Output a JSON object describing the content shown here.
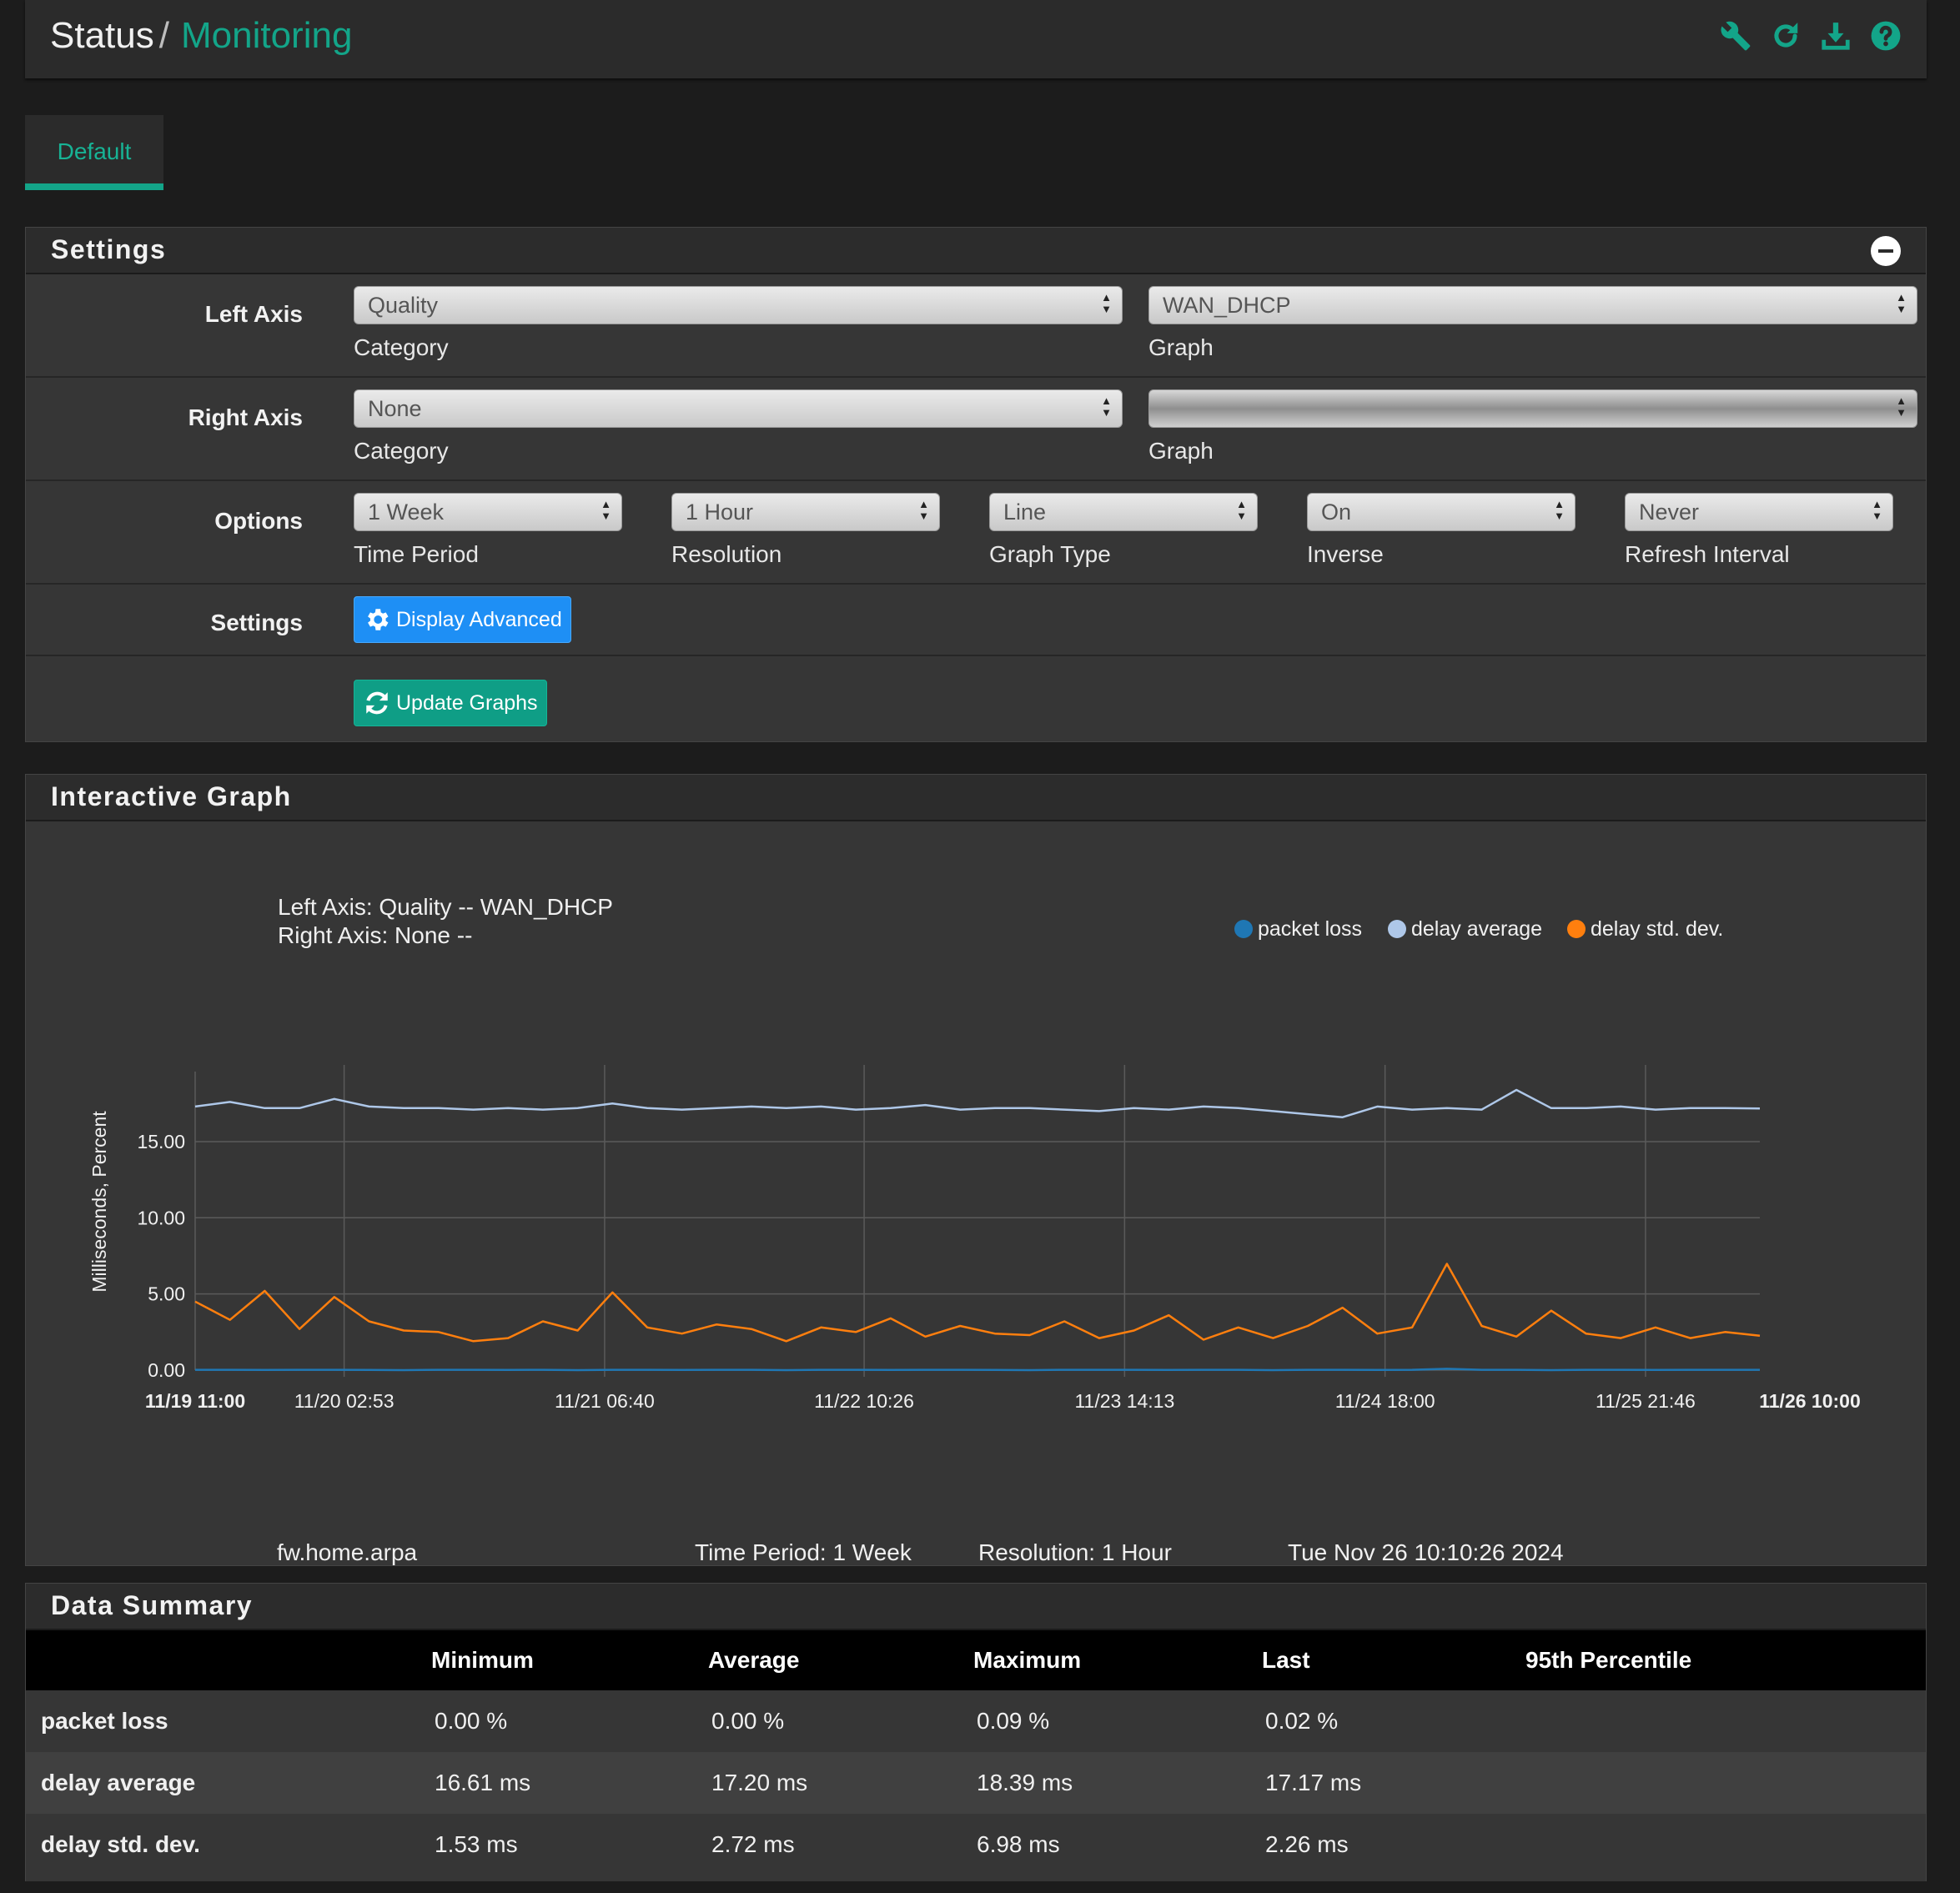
{
  "breadcrumb": {
    "root": "Status",
    "separator": "/",
    "current": "Monitoring"
  },
  "header_icons": [
    "wrench-icon",
    "refresh-icon",
    "download-icon",
    "help-icon"
  ],
  "colors": {
    "accent": "#13a589",
    "primary_button": "#1e8ff5",
    "success_button": "#0f9e86",
    "packet_loss": "#1f77b4",
    "delay_average": "#aec7e8",
    "delay_std_dev": "#ff7f0e"
  },
  "tabs": [
    {
      "label": "Default",
      "active": true
    }
  ],
  "settings": {
    "title": "Settings",
    "left_axis": {
      "label": "Left Axis",
      "category": "Quality",
      "category_label": "Category",
      "graph": "WAN_DHCP",
      "graph_label": "Graph"
    },
    "right_axis": {
      "label": "Right Axis",
      "category": "None",
      "category_label": "Category",
      "graph": "",
      "graph_label": "Graph"
    },
    "options": {
      "label": "Options",
      "time_period": {
        "value": "1 Week",
        "label": "Time Period"
      },
      "resolution": {
        "value": "1 Hour",
        "label": "Resolution"
      },
      "graph_type": {
        "value": "Line",
        "label": "Graph Type"
      },
      "inverse": {
        "value": "On",
        "label": "Inverse"
      },
      "refresh_interval": {
        "value": "Never",
        "label": "Refresh Interval"
      }
    },
    "settings_row": {
      "label": "Settings",
      "display_advanced": "Display Advanced"
    },
    "update_graphs": "Update Graphs"
  },
  "graph": {
    "title": "Interactive Graph",
    "left_axis_info": "Left Axis: Quality -- WAN_DHCP",
    "right_axis_info": "Right Axis: None --",
    "hostname": "fw.home.arpa",
    "time_period": "Time Period: 1 Week",
    "resolution": "Resolution: 1 Hour",
    "timestamp": "Tue Nov 26 10:10:26 2024"
  },
  "chart_data": {
    "type": "line",
    "ylabel": "Milliseconds, Percent",
    "ylim": [
      0,
      18.5
    ],
    "y_ticks": [
      "0.00",
      "5.00",
      "10.00",
      "15.00"
    ],
    "x_start_label": "11/19 11:00",
    "x_end_label": "11/26 10:00",
    "x_ticks": [
      "11/20 02:53",
      "11/21 06:40",
      "11/22 10:26",
      "11/23 14:13",
      "11/24 18:00",
      "11/25 21:46"
    ],
    "x_tick_hours": [
      15.9,
      43.7,
      71.4,
      99.2,
      127.0,
      154.8
    ],
    "total_hours": 167,
    "legend_position": "top-right",
    "grid": true,
    "series": [
      {
        "name": "packet loss",
        "values": [
          0.02,
          0.02,
          0.01,
          0.02,
          0.02,
          0.01,
          0.0,
          0.02,
          0.02,
          0.01,
          0.02,
          0.0,
          0.02,
          0.02,
          0.01,
          0.02,
          0.02,
          0.0,
          0.02,
          0.02,
          0.01,
          0.02,
          0.02,
          0.01,
          0.0,
          0.02,
          0.02,
          0.02,
          0.01,
          0.02,
          0.02,
          0.0,
          0.02,
          0.02,
          0.01,
          0.02,
          0.09,
          0.02,
          0.02,
          0.0,
          0.02,
          0.02,
          0.01,
          0.02,
          0.02,
          0.02
        ]
      },
      {
        "name": "delay average",
        "values": [
          17.3,
          17.6,
          17.2,
          17.2,
          17.8,
          17.3,
          17.2,
          17.2,
          17.1,
          17.2,
          17.1,
          17.2,
          17.5,
          17.2,
          17.1,
          17.2,
          17.3,
          17.2,
          17.3,
          17.1,
          17.2,
          17.4,
          17.1,
          17.2,
          17.2,
          17.1,
          17.0,
          17.2,
          17.1,
          17.3,
          17.2,
          17.0,
          16.8,
          16.6,
          17.3,
          17.1,
          17.2,
          17.1,
          18.39,
          17.2,
          17.2,
          17.3,
          17.1,
          17.2,
          17.2,
          17.17
        ]
      },
      {
        "name": "delay std. dev.",
        "values": [
          4.5,
          3.3,
          5.2,
          2.7,
          4.8,
          3.2,
          2.6,
          2.5,
          1.9,
          2.1,
          3.2,
          2.6,
          5.1,
          2.8,
          2.4,
          3.0,
          2.7,
          1.9,
          2.8,
          2.5,
          3.4,
          2.2,
          2.9,
          2.4,
          2.3,
          3.2,
          2.1,
          2.6,
          3.6,
          2.0,
          2.8,
          2.1,
          2.9,
          4.1,
          2.4,
          2.8,
          6.98,
          2.9,
          2.2,
          3.9,
          2.4,
          2.1,
          2.8,
          2.1,
          2.5,
          2.26
        ]
      }
    ]
  },
  "summary": {
    "title": "Data Summary",
    "columns": [
      "",
      "Minimum",
      "Average",
      "Maximum",
      "Last",
      "95th Percentile"
    ],
    "rows": [
      {
        "name": "packet loss",
        "min": "0.00 %",
        "avg": "0.00 %",
        "max": "0.09 %",
        "last": "0.02 %",
        "p95": ""
      },
      {
        "name": "delay average",
        "min": "16.61 ms",
        "avg": "17.20 ms",
        "max": "18.39 ms",
        "last": "17.17 ms",
        "p95": ""
      },
      {
        "name": "delay std. dev.",
        "min": "1.53 ms",
        "avg": "2.72 ms",
        "max": "6.98 ms",
        "last": "2.26 ms",
        "p95": ""
      }
    ]
  }
}
